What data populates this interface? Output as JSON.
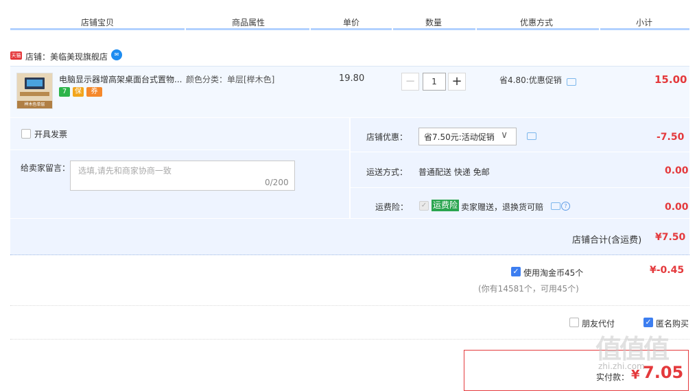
{
  "table_headers": [
    "店铺宝贝",
    "商品属性",
    "单价",
    "数量",
    "优惠方式",
    "小计"
  ],
  "shop": {
    "tag": "天猫",
    "name": "店铺：美临美现旗舰店"
  },
  "item": {
    "title": "电脑显示器增高架桌面台式置物...",
    "attributes": "颜色分类：单层[榉木色]",
    "price": "19.80",
    "quantity": "1",
    "qty_minus": "−",
    "qty_plus": "+",
    "promo": "省4.80:优惠促销",
    "subtotal": "15.00",
    "badges": [
      "7",
      "保",
      "券"
    ],
    "thumb_caption": "榉木色单层"
  },
  "options": {
    "invoice_label": "开具发票",
    "message_label": "给卖家留言：",
    "message_placeholder": "选填,请先和商家协商一致",
    "message_count": "0/200",
    "shop_discount_label": "店铺优惠：",
    "shop_discount_value": "省7.50元:活动促销",
    "shop_discount_amount": "-7.50",
    "shipping_label": "运送方式：",
    "shipping_value": "普通配送 快递 免邮",
    "shipping_amount": "0.00",
    "insurance_label": "运费险：",
    "insurance_tag": "运费险",
    "insurance_desc": "卖家赠送，退换货可赔",
    "insurance_amount": "0.00"
  },
  "shop_total": {
    "label": "店铺合计(含运费)",
    "value": "¥7.50"
  },
  "coins": {
    "label": "使用淘金币45个",
    "note": "(你有14581个，可用45个)",
    "amount": "¥-0.45"
  },
  "pay_options": {
    "friend_pay": "朋友代付",
    "anonymous": "匿名购买"
  },
  "final": {
    "label": "实付款：",
    "currency": "¥",
    "amount": "7.05"
  },
  "watermark": {
    "text": "值值值",
    "url": "zhi.zhi.com"
  },
  "colors": {
    "accent": "#e4393c",
    "blue": "#3d7ef0",
    "band": "#eef4ff",
    "header_line": "#b2d1ff"
  }
}
